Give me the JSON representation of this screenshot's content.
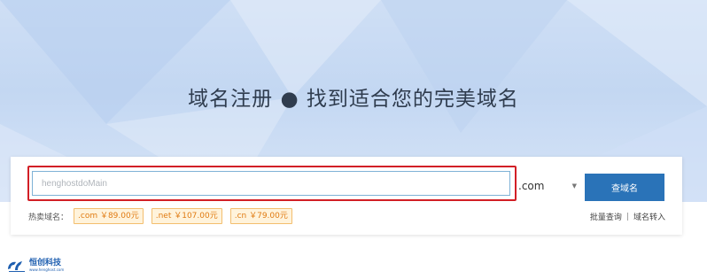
{
  "hero": {
    "title": "域名注册 ● 找到适合您的完美域名"
  },
  "search": {
    "placeholder": "henghostdoMain",
    "suffix_value": ".com",
    "caret_icon": "chevron-down-icon",
    "button_label": "查域名"
  },
  "hot_domains": {
    "label": "热卖域名：",
    "items": [
      {
        "label": ".com ￥89.00元"
      },
      {
        "label": ".net ￥107.00元"
      },
      {
        "label": ".cn ￥79.00元"
      }
    ]
  },
  "links": {
    "batch_query": "批量查询",
    "separator": "|",
    "transfer": "域名转入"
  },
  "logo": {
    "name": "恒创科技",
    "url": "www.henghost.com"
  },
  "colors": {
    "accent_button": "#2a73b8",
    "highlight_border": "#d21f26",
    "tag_background": "#fff3db",
    "tag_text": "#e07b12",
    "hero_background": "#c9dbf3"
  }
}
